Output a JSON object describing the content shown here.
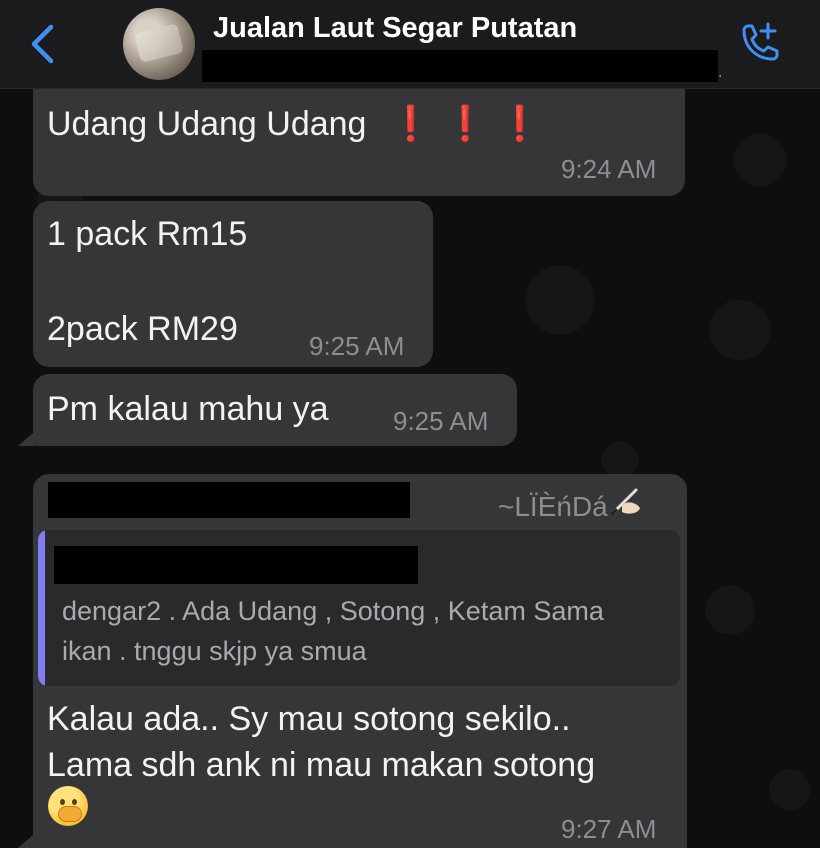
{
  "header": {
    "back_label": "",
    "title": "Jualan Laut Segar Putatan",
    "subtitle_suffix": ".",
    "call_icon": "add-call-icon"
  },
  "messages": [
    {
      "text": "Udang Udang Udang",
      "emoji": "❗❗❗",
      "time": "9:24 AM"
    },
    {
      "line1": "1 pack Rm15",
      "line2": "2pack RM29",
      "time": "9:25 AM"
    },
    {
      "text": "Pm kalau mahu ya",
      "time": "9:25 AM"
    },
    {
      "sender": "~LÏÈńDá",
      "quote": {
        "line1": "dengar2 . Ada Udang , Sotong , Ketam Sama",
        "line2": "ikan . tnggu skjp ya smua"
      },
      "line1": "Kalau ada.. Sy mau sotong sekilo..",
      "line2": "Lama sdh ank ni mau makan sotong",
      "emoji": "face-with-hand-over-mouth",
      "time": "9:27 AM"
    }
  ],
  "colors": {
    "bubble": "#363638",
    "header": "#1b1b1d",
    "accent": "#3f8ff5",
    "quote_bar": "#7f7df0"
  }
}
